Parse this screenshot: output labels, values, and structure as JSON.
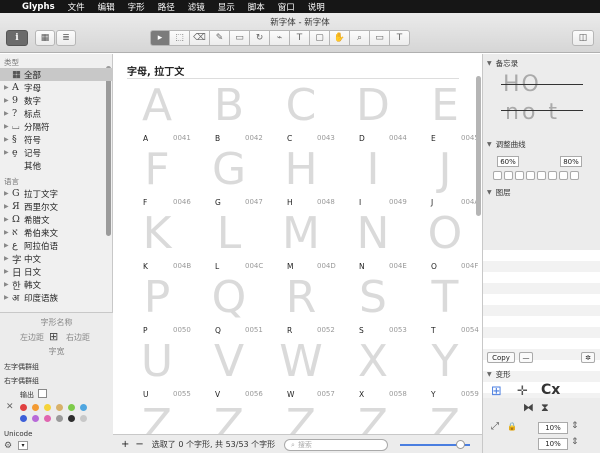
{
  "menubar": {
    "apple_icon": "",
    "app": "Glyphs",
    "items": [
      "文件",
      "编辑",
      "字形",
      "路径",
      "滤镜",
      "显示",
      "脚本",
      "窗口",
      "说明"
    ]
  },
  "window": {
    "title": "新字体 - 新字体"
  },
  "toolbar": {
    "info": "i",
    "grid": "▦",
    "list": "≣",
    "tools": [
      "select-tool",
      "draw-tool",
      "eraser-tool",
      "pen-tool",
      "rectangle-tool",
      "rotate-tool",
      "knife-tool",
      "text-tool",
      "annotation-tool",
      "hand-tool",
      "zoom-tool",
      "measure-tool",
      "kerning-tool"
    ],
    "tool_glyphs": [
      "▸",
      "⬚",
      "⌫",
      "✎",
      "▭",
      "↻",
      "⌁",
      "T",
      "▢",
      "✋",
      "⌕",
      "▭",
      "T"
    ],
    "sidebar_toggle": "◫"
  },
  "sidebar": {
    "type_header": "类型",
    "categories": [
      {
        "label": "全部",
        "glyph": "▦",
        "selected": true
      },
      {
        "label": "字母",
        "glyph": "A"
      },
      {
        "label": "数字",
        "glyph": "9"
      },
      {
        "label": "标点",
        "glyph": "?"
      },
      {
        "label": "分隔符",
        "glyph": "⌴"
      },
      {
        "label": "符号",
        "glyph": "§"
      },
      {
        "label": "记号",
        "glyph": "ȩ"
      },
      {
        "label": "其他",
        "glyph": ""
      }
    ],
    "language_header": "语言",
    "languages": [
      {
        "label": "拉丁文字",
        "glyph": "G"
      },
      {
        "label": "西里尔文",
        "glyph": "Я"
      },
      {
        "label": "希腊文",
        "glyph": "Ω"
      },
      {
        "label": "希伯来文",
        "glyph": "א"
      },
      {
        "label": "阿拉伯语",
        "glyph": "ع"
      },
      {
        "label": "中文",
        "glyph": "字"
      },
      {
        "label": "日文",
        "glyph": "日"
      },
      {
        "label": "韩文",
        "glyph": "한"
      },
      {
        "label": "印度语族",
        "glyph": "अ"
      }
    ]
  },
  "glyph_panel": {
    "name": "字形名称",
    "left_margin": "左边距",
    "right_margin": "右边距",
    "width": "字宽",
    "left_kerning": "左字偶群组",
    "right_kerning": "右字偶群组",
    "export": "输出",
    "unicode": "Unicode",
    "colors": [
      "#e04040",
      "#f39a32",
      "#f5d33a",
      "#d8b16a",
      "#7ecb4a",
      "#4fa6e0",
      "#3d5fd8",
      "#b86ad8",
      "#e066b0",
      "#9a9a9a",
      "#2e2e2e",
      "#c8c8c8"
    ]
  },
  "grid": {
    "header": "字母, 拉丁文",
    "glyphs": [
      {
        "ch": "A",
        "name": "A",
        "code": "0041"
      },
      {
        "ch": "B",
        "name": "B",
        "code": "0042"
      },
      {
        "ch": "C",
        "name": "C",
        "code": "0043"
      },
      {
        "ch": "D",
        "name": "D",
        "code": "0044"
      },
      {
        "ch": "E",
        "name": "E",
        "code": "0045"
      },
      {
        "ch": "F",
        "name": "F",
        "code": "0046"
      },
      {
        "ch": "G",
        "name": "G",
        "code": "0047"
      },
      {
        "ch": "H",
        "name": "H",
        "code": "0048"
      },
      {
        "ch": "I",
        "name": "I",
        "code": "0049"
      },
      {
        "ch": "J",
        "name": "J",
        "code": "004A"
      },
      {
        "ch": "K",
        "name": "K",
        "code": "004B"
      },
      {
        "ch": "L",
        "name": "L",
        "code": "004C"
      },
      {
        "ch": "M",
        "name": "M",
        "code": "004D"
      },
      {
        "ch": "N",
        "name": "N",
        "code": "004E"
      },
      {
        "ch": "O",
        "name": "O",
        "code": "004F"
      },
      {
        "ch": "P",
        "name": "P",
        "code": "0050"
      },
      {
        "ch": "Q",
        "name": "Q",
        "code": "0051"
      },
      {
        "ch": "R",
        "name": "R",
        "code": "0052"
      },
      {
        "ch": "S",
        "name": "S",
        "code": "0053"
      },
      {
        "ch": "T",
        "name": "T",
        "code": "0054"
      },
      {
        "ch": "U",
        "name": "U",
        "code": "0055"
      },
      {
        "ch": "V",
        "name": "V",
        "code": "0056"
      },
      {
        "ch": "W",
        "name": "W",
        "code": "0057"
      },
      {
        "ch": "X",
        "name": "X",
        "code": "0058"
      },
      {
        "ch": "Y",
        "name": "Y",
        "code": "0059"
      },
      {
        "ch": "Z",
        "name": "",
        "code": ""
      },
      {
        "ch": "Z",
        "name": "",
        "code": ""
      },
      {
        "ch": "Z",
        "name": "",
        "code": ""
      },
      {
        "ch": "Z",
        "name": "",
        "code": ""
      },
      {
        "ch": "Z",
        "name": "",
        "code": ""
      }
    ]
  },
  "bottombar": {
    "add": "+",
    "remove": "−",
    "status": "选取了 0 个字形, 共 53/53 个字形",
    "search_placeholder": "搜索",
    "zoom_level": 0.85
  },
  "right_panel": {
    "memo": "备忘录",
    "preview_text_1": "HO",
    "preview_text_2": "no t",
    "adjust": "调整曲线",
    "adjust_min": "60%",
    "adjust_max": "80%",
    "layers": "图层",
    "copy": "Copy",
    "remove": "—",
    "settings": "✲",
    "transform": "变形",
    "scale_1": "10%",
    "scale_2": "10%",
    "transform_glyph": "Cx"
  }
}
